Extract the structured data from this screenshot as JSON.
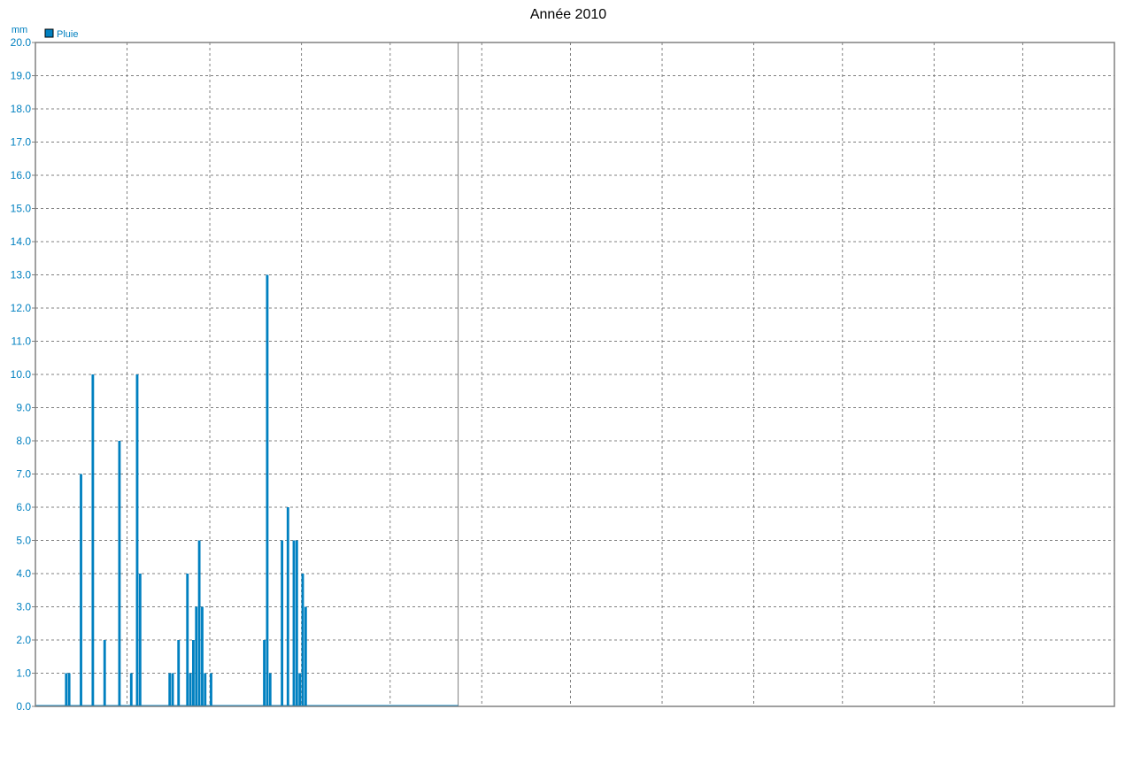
{
  "chart_data": {
    "type": "bar",
    "title": "Année 2010",
    "ylabel": "mm",
    "ylim": [
      0,
      20
    ],
    "yticks": [
      "0.0",
      "1.0",
      "2.0",
      "3.0",
      "4.0",
      "5.0",
      "6.0",
      "7.0",
      "8.0",
      "9.0",
      "10.0",
      "11.0",
      "12.0",
      "13.0",
      "14.0",
      "15.0",
      "16.0",
      "17.0",
      "18.0",
      "19.0",
      "20.0"
    ],
    "grid": true,
    "legend": "top-left",
    "series": [
      {
        "name": "Pluie",
        "color": "#0080c0",
        "x": [
          10,
          11,
          15,
          19,
          23,
          28,
          32,
          34,
          35,
          45,
          46,
          48,
          51,
          52,
          53,
          54,
          55,
          56,
          57,
          59,
          77,
          78,
          79,
          83,
          85,
          87,
          88,
          89,
          90,
          91,
          92
        ],
        "values": [
          1,
          1,
          7,
          10,
          2,
          8,
          1,
          10,
          4,
          1,
          1,
          2,
          4,
          1,
          2,
          3,
          5,
          3,
          1,
          1,
          2,
          13,
          1,
          5,
          6,
          5,
          5,
          1,
          4,
          3,
          0
        ]
      }
    ]
  },
  "colors": {
    "axis_text": "#0080c0",
    "grid": "#808080",
    "bar": "#0080c0",
    "title": "#000000"
  }
}
